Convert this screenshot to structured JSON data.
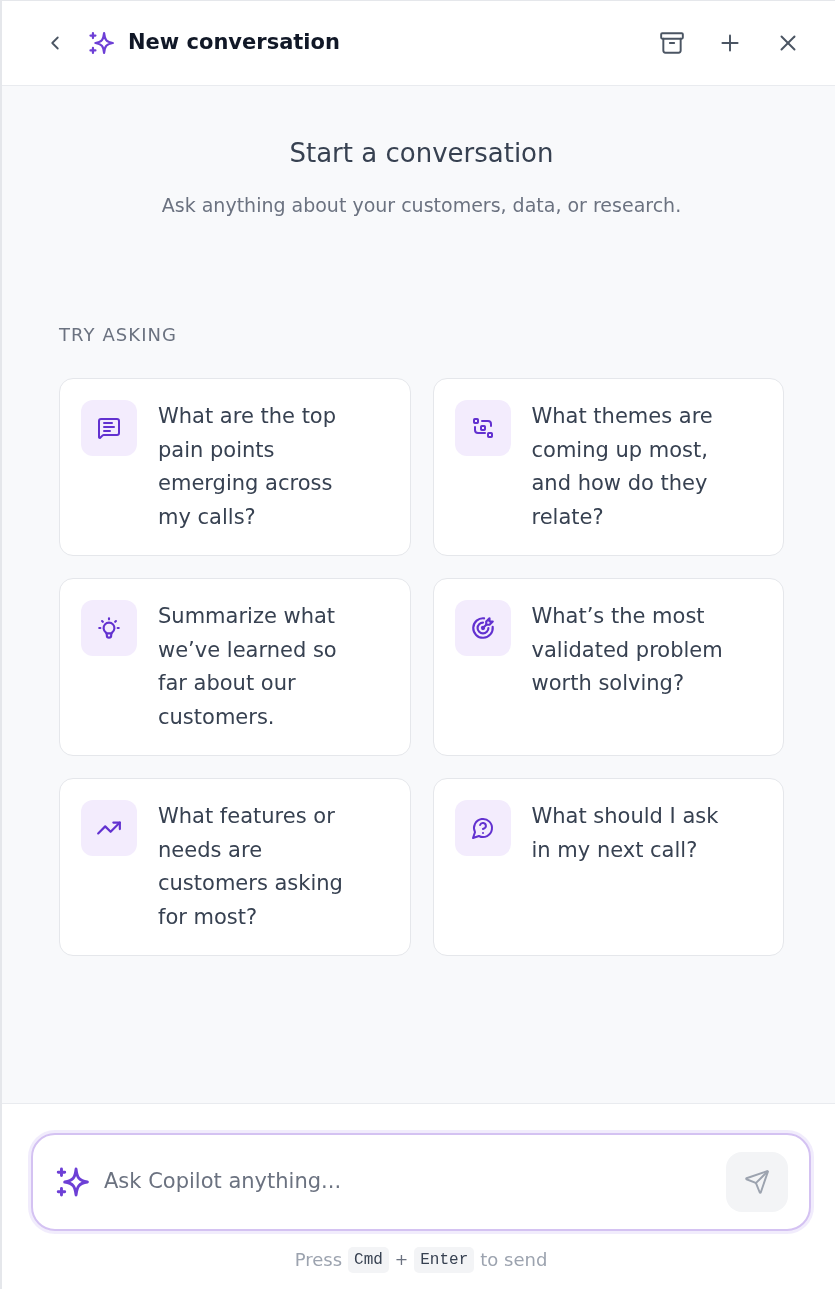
{
  "header": {
    "title": "New conversation"
  },
  "intro": {
    "heading": "Start a conversation",
    "subtitle": "Ask anything about your customers, data, or research."
  },
  "suggestions": {
    "label": "TRY ASKING",
    "cards": [
      {
        "text": "What are the top pain points emerging across my calls?"
      },
      {
        "text": "What themes are coming up most, and how do they relate?"
      },
      {
        "text": "Summarize what we’ve learned so far about our customers."
      },
      {
        "text": "What’s the most validated problem worth solving?"
      },
      {
        "text": "What features or needs are customers asking for most?"
      },
      {
        "text": "What should I ask in my next call?"
      }
    ]
  },
  "composer": {
    "placeholder": "Ask Copilot anything...",
    "hint": {
      "before": "Press",
      "keys": [
        "Cmd",
        "Enter"
      ],
      "separator": "+",
      "after": "to send"
    }
  }
}
